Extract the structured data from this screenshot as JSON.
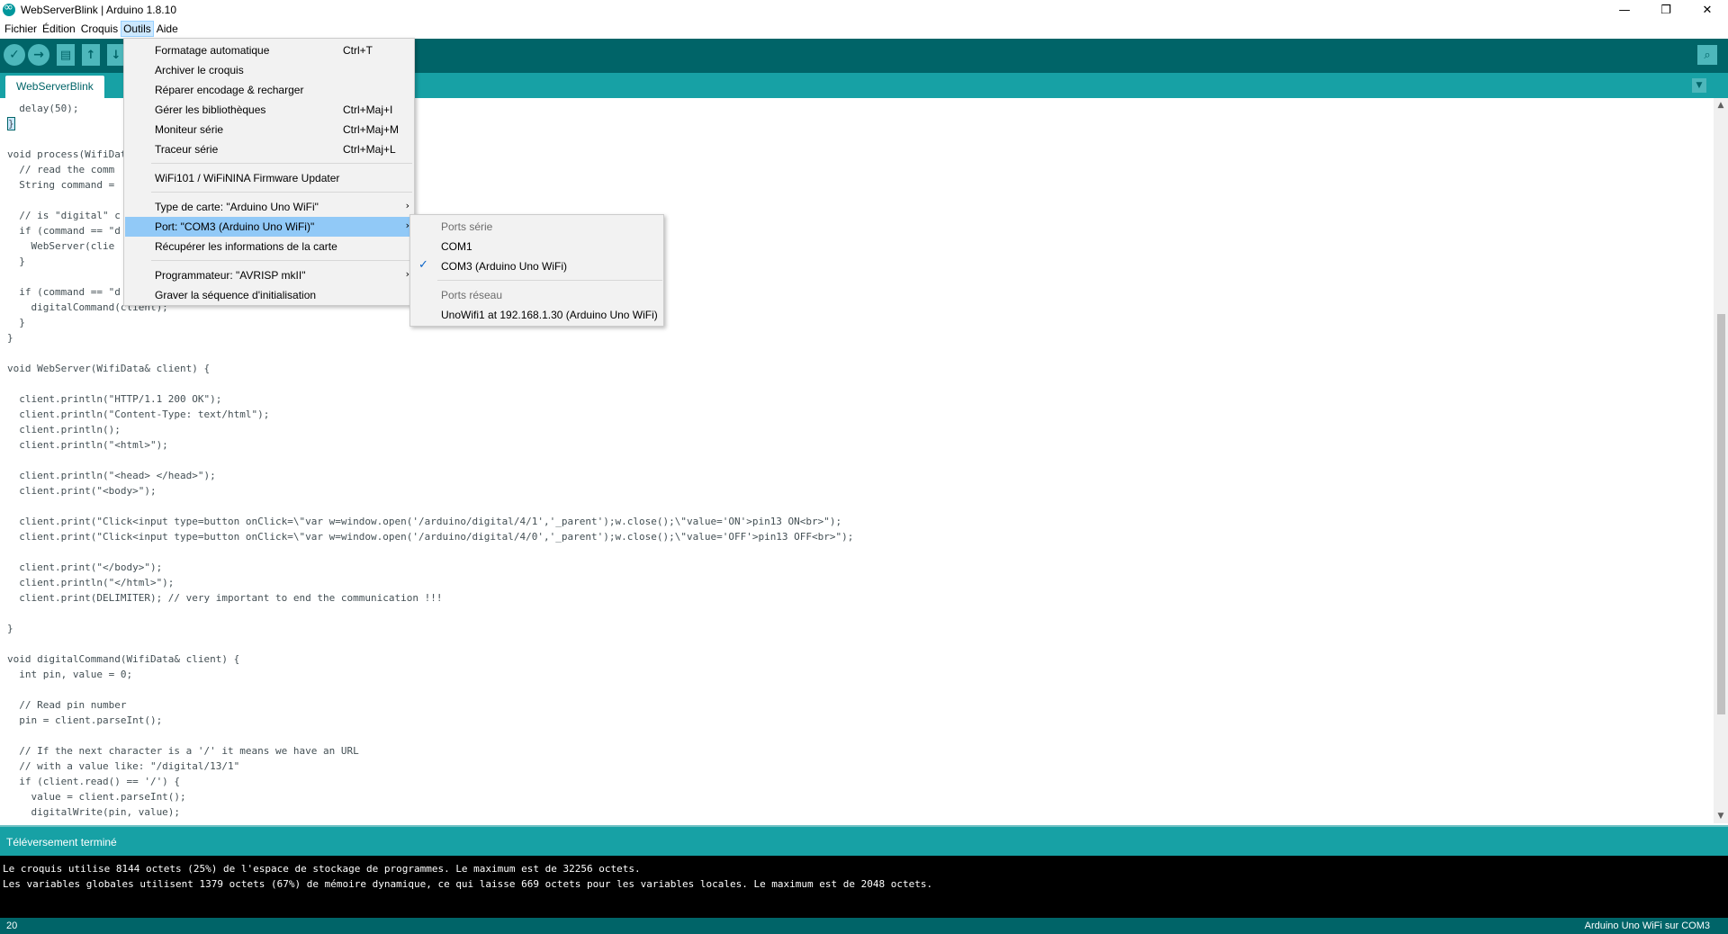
{
  "window": {
    "title": "WebServerBlink | Arduino 1.8.10",
    "controls": {
      "minimize": "—",
      "maximize": "❐",
      "close": "✕"
    }
  },
  "menubar": {
    "items": [
      "Fichier",
      "Édition",
      "Croquis",
      "Outils",
      "Aide"
    ],
    "active": "Outils"
  },
  "toolbar": {
    "icons": [
      "verify-icon",
      "upload-icon",
      "new-icon",
      "open-icon",
      "save-icon",
      "serial-monitor-icon"
    ]
  },
  "tabs": {
    "active": "WebServerBlink"
  },
  "editor": {
    "lines": [
      "  delay(50);",
      "}",
      "",
      "void process(WifiData",
      "  // read the comm",
      "  String command = ",
      "",
      "  // is \"digital\" c",
      "  if (command == \"d",
      "    WebServer(clie",
      "  }",
      "",
      "  if (command == \"d",
      "    digitalCommand(client);",
      "  }",
      "}",
      "",
      "void WebServer(WifiData& client) {",
      "",
      "  client.println(\"HTTP/1.1 200 OK\");",
      "  client.println(\"Content-Type: text/html\");",
      "  client.println();",
      "  client.println(\"<html>\");",
      "",
      "  client.println(\"<head> </head>\");",
      "  client.print(\"<body>\");",
      "",
      "  client.print(\"Click<input type=button onClick=\\\"var w=window.open('/arduino/digital/4/1','_parent');w.close();\\\"value='ON'>pin13 ON<br>\");",
      "  client.print(\"Click<input type=button onClick=\\\"var w=window.open('/arduino/digital/4/0','_parent');w.close();\\\"value='OFF'>pin13 OFF<br>\");",
      "",
      "  client.print(\"</body>\");",
      "  client.println(\"</html>\");",
      "  client.print(DELIMITER); // very important to end the communication !!!",
      "",
      "}",
      "",
      "void digitalCommand(WifiData& client) {",
      "  int pin, value = 0;",
      "",
      "  // Read pin number",
      "  pin = client.parseInt();",
      "",
      "  // If the next character is a '/' it means we have an URL",
      "  // with a value like: \"/digital/13/1\"",
      "  if (client.read() == '/') {",
      "    value = client.parseInt();",
      "    digitalWrite(pin, value);"
    ]
  },
  "outils_menu": {
    "items": [
      {
        "label": "Formatage automatique",
        "shortcut": "Ctrl+T"
      },
      {
        "label": "Archiver le croquis",
        "shortcut": ""
      },
      {
        "label": "Réparer encodage & recharger",
        "shortcut": ""
      },
      {
        "label": "Gérer les bibliothèques",
        "shortcut": "Ctrl+Maj+I"
      },
      {
        "label": "Moniteur série",
        "shortcut": "Ctrl+Maj+M"
      },
      {
        "label": "Traceur série",
        "shortcut": "Ctrl+Maj+L"
      },
      {
        "label": "WiFi101 / WiFiNINA Firmware Updater",
        "shortcut": ""
      },
      {
        "label": "Type de carte: \"Arduino Uno WiFi\"",
        "shortcut": ""
      },
      {
        "label": "Port: \"COM3 (Arduino Uno WiFi)\"",
        "shortcut": ""
      },
      {
        "label": "Récupérer les informations de la carte",
        "shortcut": ""
      },
      {
        "label": "Programmateur: \"AVRISP mkII\"",
        "shortcut": ""
      },
      {
        "label": "Graver la séquence d'initialisation",
        "shortcut": ""
      }
    ],
    "submenu_arrow": "›"
  },
  "port_submenu": {
    "serial_header": "Ports série",
    "serial_ports": [
      "COM1",
      "COM3 (Arduino Uno WiFi)"
    ],
    "selected": "COM3 (Arduino Uno WiFi)",
    "network_header": "Ports réseau",
    "network_ports": [
      "UnoWifi1 at 192.168.1.30 (Arduino Uno WiFi)"
    ]
  },
  "status": {
    "message": "Téléversement terminé"
  },
  "console": {
    "lines": [
      "Le croquis utilise 8144 octets (25%) de l'espace de stockage de programmes. Le maximum est de 32256 octets.",
      "Les variables globales utilisent 1379 octets (67%) de mémoire dynamique, ce qui laisse 669 octets pour les variables locales. Le maximum est de 2048 octets."
    ]
  },
  "footer": {
    "line_number": "20",
    "board": "Arduino Uno WiFi sur COM3"
  },
  "colors": {
    "toolbar": "#006468",
    "tabbar": "#17a1a5",
    "highlight": "#91c9f7",
    "console_bg": "#000000"
  }
}
